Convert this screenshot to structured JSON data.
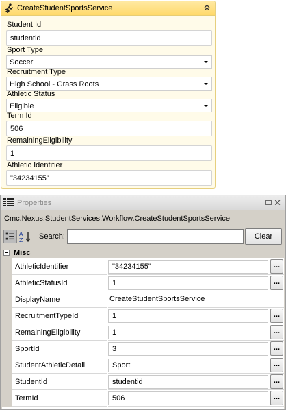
{
  "activity": {
    "title": "CreateStudentSportsService",
    "icons": {
      "activity": "runner-icon",
      "collapse": "double-chevron-up-icon"
    },
    "fields": {
      "student_id_label": "Student Id",
      "student_id_value": "studentid",
      "sport_type_label": "Sport Type",
      "sport_type_value": "Soccer",
      "recruitment_type_label": "Recruitment Type",
      "recruitment_type_value": "High School - Grass Roots",
      "athletic_status_label": "Athletic Status",
      "athletic_status_value": "Eligible",
      "term_id_label": "Term Id",
      "term_id_value": "506",
      "remaining_eligibility_label": "RemainingEligibility",
      "remaining_eligibility_value": "1",
      "athletic_identifier_label": "Athletic Identifier",
      "athletic_identifier_value": "\"34234155\""
    }
  },
  "properties": {
    "title": "Properties",
    "type_name": "Cmc.Nexus.StudentServices.Workflow.CreateStudentSportsService",
    "search_label": "Search:",
    "search_value": "",
    "clear_label": "Clear",
    "category": "Misc",
    "rows": [
      {
        "name": "AthleticIdentifier",
        "value": "\"34234155\""
      },
      {
        "name": "AthleticStatusId",
        "value": "1"
      },
      {
        "name": "DisplayName",
        "value": "CreateStudentSportsService"
      },
      {
        "name": "RecruitmentTypeId",
        "value": "1"
      },
      {
        "name": "RemainingEligibility",
        "value": "1"
      },
      {
        "name": "SportId",
        "value": "3"
      },
      {
        "name": "StudentAthleticDetail",
        "value": "Sport"
      },
      {
        "name": "StudentId",
        "value": "studentid"
      },
      {
        "name": "TermId",
        "value": "506"
      }
    ],
    "ellipsis": "..."
  }
}
